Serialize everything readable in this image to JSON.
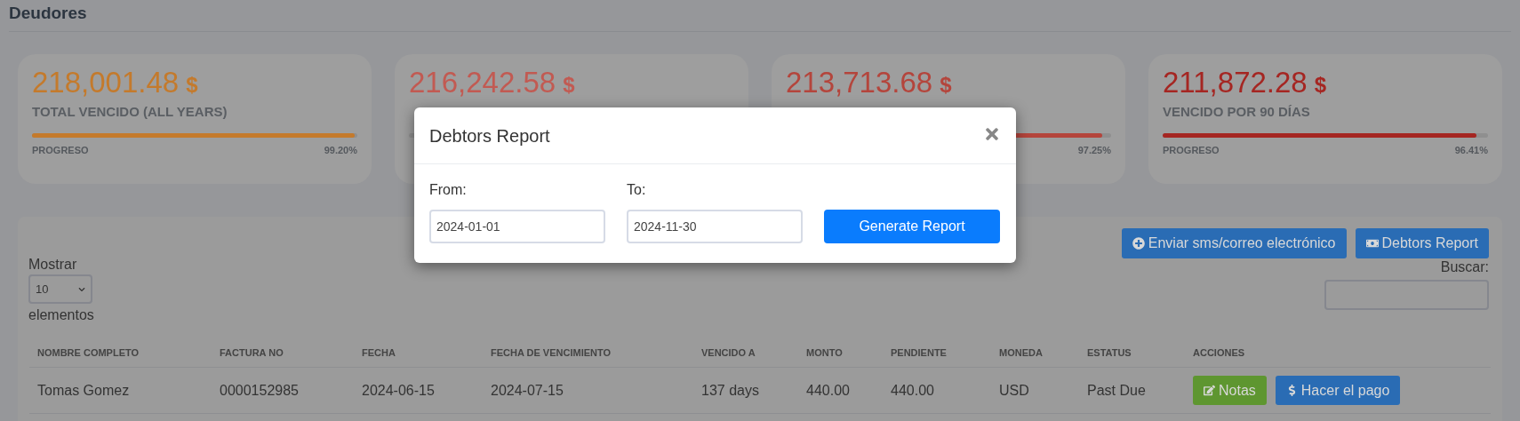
{
  "page": {
    "title": "Deudores"
  },
  "cards": [
    {
      "amount": "218,001.48",
      "currency": "$",
      "label": "TOTAL VENCIDO (ALL YEARS)",
      "color": "#c47a2c",
      "progress_label": "PROGRESO",
      "percent": "99.20%",
      "level": 0.992
    },
    {
      "amount": "216,242.58",
      "currency": "$",
      "color": "#c25a52"
    },
    {
      "amount": "213,713.68",
      "currency": "$",
      "color": "#b4453c",
      "percent": "97.25%",
      "level": 0.9725
    },
    {
      "amount": "211,872.28",
      "currency": "$",
      "label": "VENCIDO POR 90 DÍAS",
      "color": "#a52622",
      "progress_label": "PROGRESO",
      "percent": "96.41%",
      "level": 0.9641
    }
  ],
  "toolbar": [
    {
      "label": "Enviar sms/correo electrónico",
      "kind": "send"
    },
    {
      "label": "Debtors Report",
      "kind": "report"
    }
  ],
  "length_menu": {
    "before": "Mostrar",
    "value": "10",
    "after": "elementos"
  },
  "search": {
    "label": "Buscar:"
  },
  "table": {
    "columns": [
      "NOMBRE COMPLETO",
      "FACTURA NO",
      "FECHA",
      "FECHA DE VENCIMIENTO",
      "VENCIDO A",
      "MONTO",
      "PENDIENTE",
      "MONEDA",
      "ESTATUS",
      "ACCIONES"
    ],
    "rows": [
      {
        "cells": [
          "Tomas Gomez",
          "0000152985",
          "2024-06-15",
          "2024-07-15",
          "137 days",
          "440.00",
          "440.00",
          "USD",
          "Past Due"
        ],
        "actions": [
          {
            "label": "Notas",
            "kind": "notes"
          },
          {
            "label": "Hacer el pago",
            "kind": "pay"
          }
        ]
      }
    ]
  },
  "modal": {
    "title": "Debtors Report",
    "from_label": "From:",
    "from_value": "2024-01-01",
    "to_label": "To:",
    "to_value": "2024-11-30",
    "submit": "Generate Report"
  }
}
